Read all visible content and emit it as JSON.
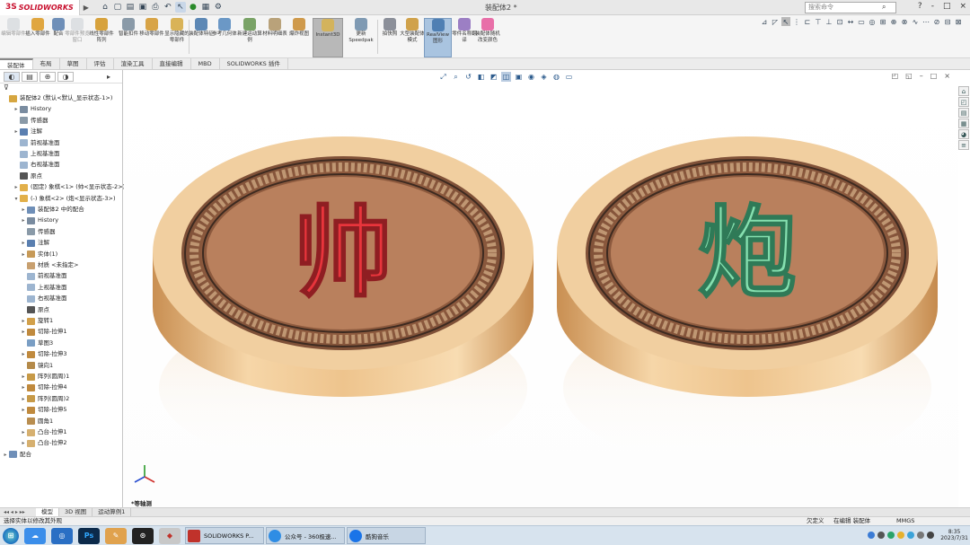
{
  "titlebar": {
    "logo_ds": "3S",
    "logo_text": "SOLIDWORKS",
    "doc_title": "装配体2 *",
    "search_placeholder": "搜索命令",
    "window_controls": [
      "?",
      "-",
      "□",
      "×"
    ]
  },
  "ribbon": {
    "buttons": [
      {
        "label": "编辑零部件",
        "icon": "edit-component-icon",
        "greyed": true
      },
      {
        "label": "插入零部件",
        "icon": "insert-component-icon"
      },
      {
        "label": "配合",
        "icon": "mate-icon"
      },
      {
        "label": "零部件预览窗口",
        "icon": "component-preview-icon",
        "greyed": true
      },
      {
        "label": "线性零部件阵列",
        "icon": "linear-pattern-icon"
      },
      {
        "label": "智能扣件",
        "icon": "smart-fasteners-icon"
      },
      {
        "label": "移动零部件",
        "icon": "move-component-icon"
      },
      {
        "label": "显示隐藏的零部件",
        "icon": "show-hidden-icon"
      },
      {
        "label": "装配体特征",
        "icon": "assembly-feature-icon"
      },
      {
        "label": "参考几何体",
        "icon": "reference-geometry-icon"
      },
      {
        "label": "新建运动算例",
        "icon": "motion-study-icon"
      },
      {
        "label": "材料明细表",
        "icon": "bom-icon"
      },
      {
        "label": "爆炸视图",
        "icon": "exploded-view-icon"
      },
      {
        "label": "Instant3D",
        "icon": "instant3d-icon",
        "selected": true
      },
      {
        "label": "更新Speedpak",
        "icon": "speedpak-icon"
      },
      {
        "label": "拍快照",
        "icon": "snapshot-icon"
      },
      {
        "label": "大型装配体模式",
        "icon": "large-assembly-icon"
      },
      {
        "label": "RealView图形",
        "icon": "realview-icon",
        "highlight": true
      },
      {
        "label": "零件名称翻译",
        "icon": "translate-icon"
      },
      {
        "label": "装配体随机改变颜色",
        "icon": "random-color-icon"
      }
    ]
  },
  "command_tabs": [
    "装配体",
    "布局",
    "草图",
    "评估",
    "渲染工具",
    "直接编辑",
    "MBD",
    "SOLIDWORKS 插件"
  ],
  "feature_tree": {
    "items": [
      {
        "label": "装配体2 (默认<默认_显示状态-1>)",
        "level": 0,
        "toggle": "",
        "icon": "assembly-icon"
      },
      {
        "label": "History",
        "level": 1,
        "toggle": "▸",
        "icon": "history-icon"
      },
      {
        "label": "传感器",
        "level": 1,
        "toggle": "",
        "icon": "sensor-icon"
      },
      {
        "label": "注解",
        "level": 1,
        "toggle": "▸",
        "icon": "annotation-icon"
      },
      {
        "label": "前视基准面",
        "level": 1,
        "toggle": "",
        "icon": "plane-icon"
      },
      {
        "label": "上视基准面",
        "level": 1,
        "toggle": "",
        "icon": "plane-icon"
      },
      {
        "label": "右视基准面",
        "level": 1,
        "toggle": "",
        "icon": "plane-icon"
      },
      {
        "label": "原点",
        "level": 1,
        "toggle": "",
        "icon": "origin-icon"
      },
      {
        "label": "(固定) 象棋<1> (帅<显示状态-2>)",
        "level": 1,
        "toggle": "▸",
        "icon": "part-icon"
      },
      {
        "label": "(-) 象棋<2> (炮<显示状态-3>)",
        "level": 1,
        "toggle": "▾",
        "icon": "part-icon"
      },
      {
        "label": "装配体2 中的配合",
        "level": 2,
        "toggle": "▸",
        "icon": "mate-icon"
      },
      {
        "label": "History",
        "level": 2,
        "toggle": "▸",
        "icon": "history-icon"
      },
      {
        "label": "传感器",
        "level": 2,
        "toggle": "",
        "icon": "sensor-icon"
      },
      {
        "label": "注解",
        "level": 2,
        "toggle": "▸",
        "icon": "annotation-icon"
      },
      {
        "label": "实体(1)",
        "level": 2,
        "toggle": "▸",
        "icon": "solid-body-icon"
      },
      {
        "label": "材质 <未指定>",
        "level": 2,
        "toggle": "",
        "icon": "material-icon"
      },
      {
        "label": "前视基准面",
        "level": 2,
        "toggle": "",
        "icon": "plane-icon"
      },
      {
        "label": "上视基准面",
        "level": 2,
        "toggle": "",
        "icon": "plane-icon"
      },
      {
        "label": "右视基准面",
        "level": 2,
        "toggle": "",
        "icon": "plane-icon"
      },
      {
        "label": "原点",
        "level": 2,
        "toggle": "",
        "icon": "origin-icon"
      },
      {
        "label": "旋转1",
        "level": 2,
        "toggle": "▸",
        "icon": "revolve-icon"
      },
      {
        "label": "切除-拉伸1",
        "level": 2,
        "toggle": "▸",
        "icon": "cut-extrude-icon"
      },
      {
        "label": "草图3",
        "level": 2,
        "toggle": "",
        "icon": "sketch-icon"
      },
      {
        "label": "切除-拉伸3",
        "level": 2,
        "toggle": "▸",
        "icon": "cut-extrude-icon"
      },
      {
        "label": "镜向1",
        "level": 2,
        "toggle": "",
        "icon": "mirror-icon"
      },
      {
        "label": "阵列(圆周)1",
        "level": 2,
        "toggle": "▸",
        "icon": "circular-pattern-icon"
      },
      {
        "label": "切除-拉伸4",
        "level": 2,
        "toggle": "▸",
        "icon": "cut-extrude-icon"
      },
      {
        "label": "阵列(圆周)2",
        "level": 2,
        "toggle": "▸",
        "icon": "circular-pattern-icon"
      },
      {
        "label": "切除-拉伸5",
        "level": 2,
        "toggle": "▸",
        "icon": "cut-extrude-icon"
      },
      {
        "label": "圆角1",
        "level": 2,
        "toggle": "",
        "icon": "fillet-icon"
      },
      {
        "label": "凸台-拉伸1",
        "level": 2,
        "toggle": "▸",
        "icon": "boss-extrude-icon"
      },
      {
        "label": "凸台-拉伸2",
        "level": 2,
        "toggle": "▸",
        "icon": "boss-extrude-icon"
      },
      {
        "label": "配合",
        "level": 0,
        "toggle": "▸",
        "icon": "mate-icon"
      }
    ]
  },
  "viewport": {
    "pieces": [
      {
        "char": "帅",
        "color": "#e8353c"
      },
      {
        "char": "炮",
        "color": "#86e0b0"
      }
    ],
    "view_label": "*等轴测"
  },
  "bottom_tabs": [
    "模型",
    "3D 视图",
    "运动算例1"
  ],
  "status_bar": {
    "message": "选择实体以修改其外观",
    "state": "欠定义",
    "mode": "在编辑 装配体",
    "units": "MMGS"
  },
  "taskbar": {
    "apps": [
      {
        "label": "SOLIDWORKS P...",
        "color": "#c0322b"
      },
      {
        "label": "公众号 - 360极速...",
        "color": "#2f8de4"
      },
      {
        "label": "酷狗音乐",
        "color": "#1a74e8"
      }
    ],
    "time": "8:35",
    "date": "2023/7/31"
  }
}
